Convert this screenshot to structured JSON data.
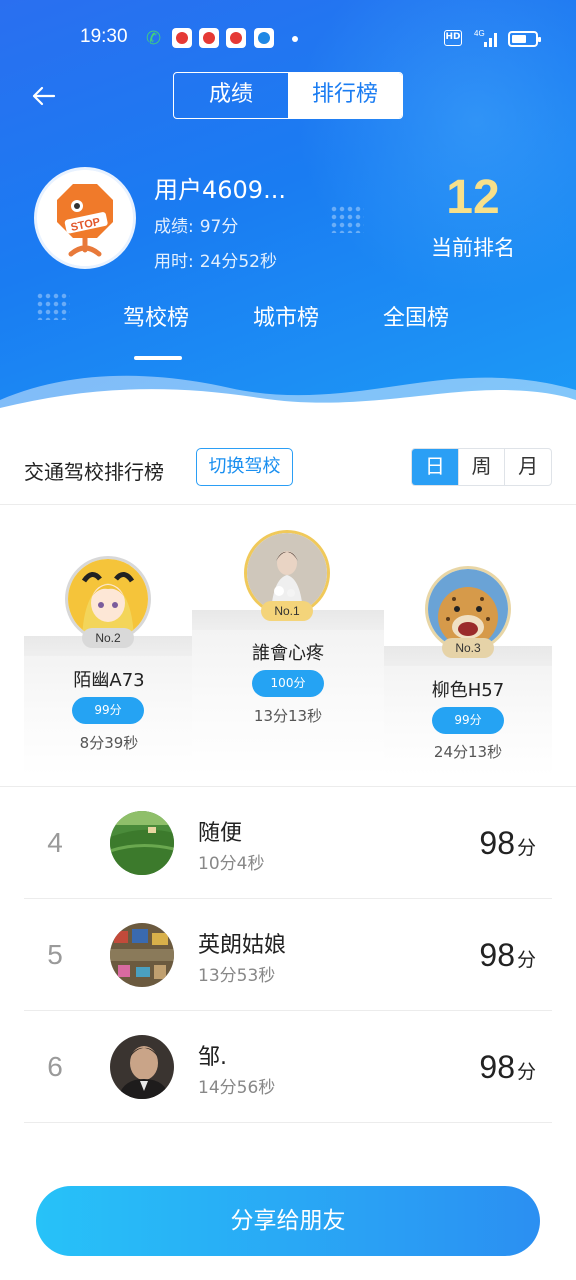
{
  "status_bar": {
    "time": "19:30",
    "hd": "HD",
    "network": "4G"
  },
  "nav": {
    "tabs": [
      {
        "label": "成绩",
        "active": false
      },
      {
        "label": "排行榜",
        "active": true
      }
    ]
  },
  "user": {
    "name": "用户4609...",
    "score_label": "成绩:",
    "score_value": "97分",
    "time_label": "用时:",
    "time_value": "24分52秒",
    "rank": "12",
    "rank_label": "当前排名"
  },
  "scope_tabs": [
    "驾校榜",
    "城市榜",
    "全国榜"
  ],
  "list_header": {
    "title": "交通驾校排行榜",
    "switch_label": "切换驾校",
    "periods": [
      "日",
      "周",
      "月"
    ],
    "active_period": "日"
  },
  "podium": [
    {
      "badge": "No.1",
      "name": "誰會心疼",
      "score": "100分",
      "time": "13分13秒"
    },
    {
      "badge": "No.2",
      "name": "陌幽A73",
      "score": "99分",
      "time": "8分39秒"
    },
    {
      "badge": "No.3",
      "name": "柳色H57",
      "score": "99分",
      "time": "24分13秒"
    }
  ],
  "ranks": [
    {
      "rank": "4",
      "name": "随便",
      "time": "10分4秒",
      "score": "98",
      "unit": "分"
    },
    {
      "rank": "5",
      "name": "英朗姑娘",
      "time": "13分53秒",
      "score": "98",
      "unit": "分"
    },
    {
      "rank": "6",
      "name": "邹.",
      "time": "14分56秒",
      "score": "98",
      "unit": "分"
    }
  ],
  "share_label": "分享给朋友",
  "colors": {
    "brand_blue": "#1a7cf2",
    "rank_gold": "#f7e08a",
    "pill_blue": "#25a3f3"
  }
}
